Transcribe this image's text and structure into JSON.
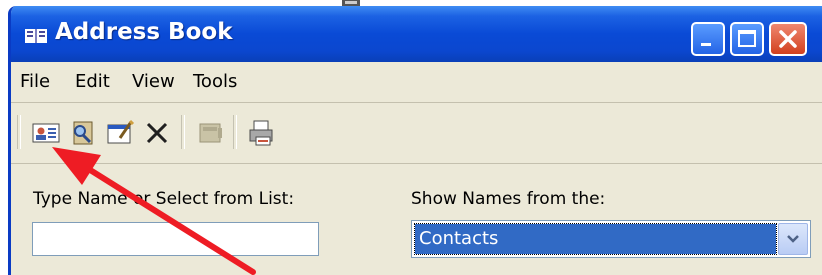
{
  "window": {
    "title": "Address Book",
    "title_icon": "address-book-icon"
  },
  "titlebar_buttons": [
    "minimize-icon",
    "maximize-icon",
    "close-icon"
  ],
  "menu": {
    "items": [
      "File",
      "Edit",
      "View",
      "Tools"
    ]
  },
  "toolbar": {
    "tools": [
      "new-contact-icon",
      "find-people-icon",
      "properties-icon",
      "delete-icon",
      "action-icon",
      "print-icon"
    ]
  },
  "search": {
    "label": "Type Name or Select from List:",
    "value": ""
  },
  "show_names": {
    "label": "Show Names from the:",
    "selected": "Contacts"
  },
  "annotation": {
    "arrow_color": "#ee1c24",
    "points_to": "new-contact-icon"
  },
  "colors": {
    "titlebar": "#0a4ad6",
    "face": "#ece9d8",
    "selection": "#316ac5"
  }
}
